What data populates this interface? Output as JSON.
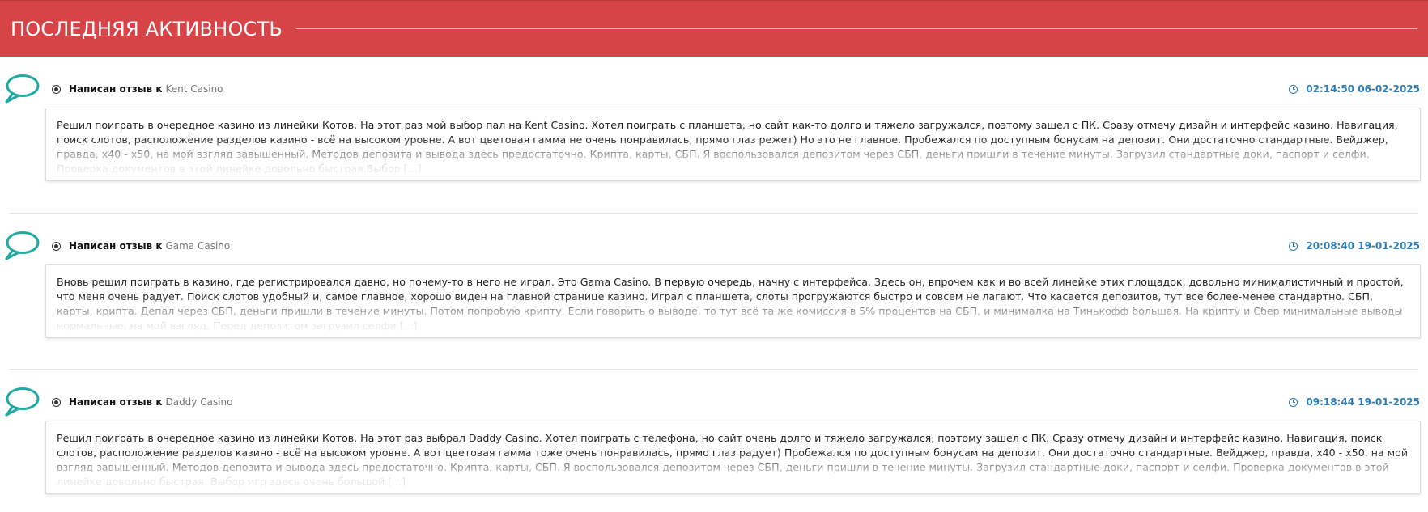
{
  "header": {
    "title": "ПОСЛЕДНЯЯ АКТИВНОСТЬ",
    "background": "#d74447"
  },
  "colors": {
    "bubble": "#1fa9a1",
    "timestamp": "#2e7cb5"
  },
  "entries": [
    {
      "icon": "speech-bubble-icon",
      "prefix": "Написан отзыв к",
      "casino": "Kent Casino",
      "timestamp": "02:14:50 06-02-2025",
      "text": "Решил поиграть в очередное казино из линейки Котов. На этот раз мой выбор пал на Kent Casino. Хотел поиграть с планшета, но сайт как-то долго и тяжело загружался, поэтому зашел с ПК. Сразу отмечу дизайн и интерфейс казино. Навигация, поиск слотов, расположение разделов казино - всё на высоком уровне. А вот цветовая гамма не очень понравилась, прямо глаз режет) Но это не главное. Пробежался по доступным бонусам на депозит. Они достаточно стандартные. Вейджер, правда, x40 - x50, на мой взгляд завышенный. Методов депозита и вывода здесь предостаточно. Крипта, карты, СБП. Я воспользовался депозитом через СБП, деньги пришли в течение минуты. Загрузил стандартные доки, паспорт и селфи. Проверка документов в этой линейке довольно быстрая.Выбор [...]"
    },
    {
      "icon": "speech-bubble-icon",
      "prefix": "Написан отзыв к",
      "casino": "Gama Casino",
      "timestamp": "20:08:40 19-01-2025",
      "text": "Вновь решил поиграть в казино, где регистрировался давно, но почему-то в него не играл. Это Gama Casino. В первую очередь, начну с интерфейса. Здесь он, впрочем как и во всей линейке этих площадок, довольно минималистичный и простой, что меня очень радует. Поиск слотов удобный и, самое главное, хорошо виден на главной странице казино. Играл с планшета, слоты прогружаются быстро и совсем не лагают. Что касается депозитов, тут все более-менее стандартно. СБП, карты, крипта. Депал через СБП, деньги пришли в течение минуты. Потом попробую крипту. Если говорить о выводе, то тут всё та же комиссия в 5% процентов на СБП, и минималка на Тинькофф большая. На крипту и Сбер минимальные выводы нормальные, на мой взгляд. Перед депозитом загрузил селфи [...]"
    },
    {
      "icon": "speech-bubble-icon",
      "prefix": "Написан отзыв к",
      "casino": "Daddy Casino",
      "timestamp": "09:18:44 19-01-2025",
      "text": "Решил поиграть в очередное казино из линейки Котов. На этот раз выбрал Daddy Casino. Хотел поиграть с телефона, но сайт очень долго и тяжело загружался, поэтому зашел с ПК. Сразу отмечу дизайн и интерфейс казино. Навигация, поиск слотов, расположение разделов казино - всё на высоком уровне. А вот цветовая гамма тоже очень понравилась, прямо глаз радует) Пробежался по доступным бонусам на депозит. Они достаточно стандартные. Вейджер, правда, x40 - x50, на мой взгляд завышенный.  Методов депозита и вывода здесь предостаточно. Крипта, карты, СБП. Я воспользовался депозитом через СБП, деньги пришли в течение минуты. Загрузил стандартные доки, паспорт и селфи. Проверка документов в этой линейке довольно быстрая. Выбор игр здесь очень большой [...]"
    }
  ]
}
